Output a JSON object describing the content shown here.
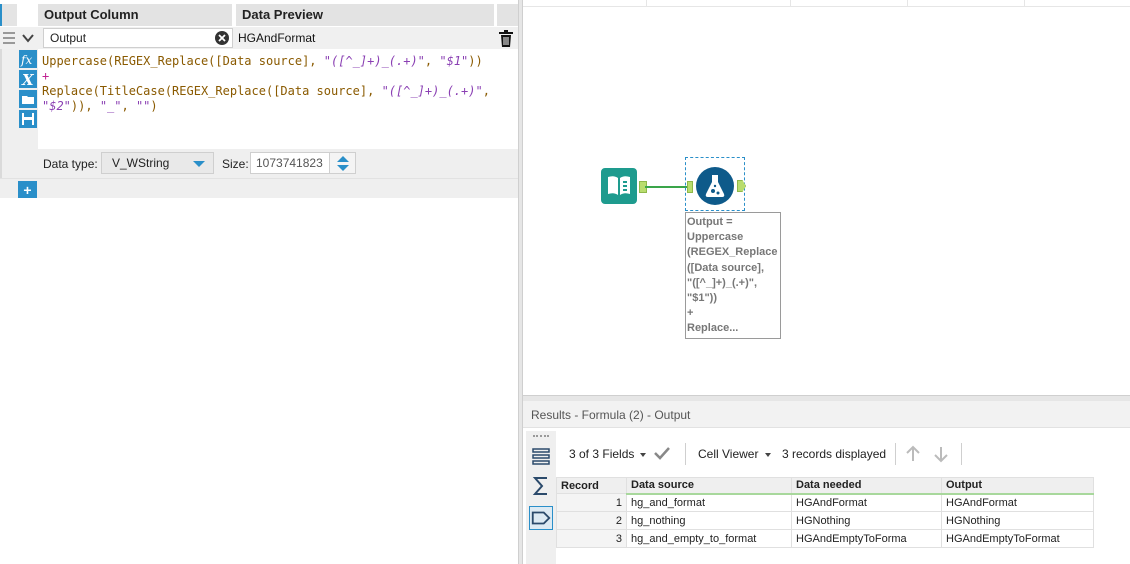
{
  "config": {
    "header": {
      "output_column": "Output Column",
      "data_preview": "Data Preview"
    },
    "expression_row": {
      "output_field": "Output",
      "preview_value": "HGAndFormat"
    },
    "expression": {
      "line1_fn": "Uppercase(REGEX_Replace([Data source], ",
      "line1_pattern": "\"([^_]+)_(.+)\"",
      "line1_sep": ", ",
      "line1_replacement": "\"$1\"",
      "line1_close": "))",
      "line2": "+",
      "line3_fn": "Replace(TitleCase(REGEX_Replace([Data source], ",
      "line3_pattern": "\"([^_]+)_(.+)\"",
      "line3_sep": ",",
      "line4_replacement": "\"$2\"",
      "line4_mid": ")), ",
      "line4_find": "\"_\"",
      "line4_sep": ", ",
      "line4_empty": "\"\"",
      "line4_close": ")"
    },
    "data_type_label": "Data type:",
    "data_type_value": "V_WString",
    "size_label": "Size:",
    "size_value": "1073741823",
    "add_label": "+"
  },
  "canvas": {
    "annotation": "Output =\nUppercase\n(REGEX_Replace\n([Data source],\n\"([^_]+)_(.+)\",\n\"$1\"))\n+\nReplace..."
  },
  "results": {
    "title": "Results - Formula (2) - Output",
    "fields_count": "3 of 3 Fields",
    "cell_viewer": "Cell Viewer",
    "records_displayed": "3 records displayed",
    "columns": [
      "Record",
      "Data source",
      "Data needed",
      "Output"
    ],
    "rows": [
      {
        "record": "1",
        "data_source": "hg_and_format",
        "data_needed": "HGAndFormat",
        "output": "HGAndFormat"
      },
      {
        "record": "2",
        "data_source": "hg_nothing",
        "data_needed": "HGNothing",
        "output": "HGNothing"
      },
      {
        "record": "3",
        "data_source": "hg_and_empty_to_format",
        "data_needed": "HGAndEmptyToForma",
        "output": "HGAndEmptyToFormat"
      }
    ]
  },
  "colors": {
    "accent_blue": "#2a8fc9",
    "tool_teal": "#1e9b8e",
    "tool_navy": "#0e5a8a",
    "connection_green": "#3aa54a",
    "string_purple": "#8a3fb3",
    "function_brown": "#8a5a00"
  },
  "icons": [
    "grip-icon",
    "chevron-down-icon",
    "clear-icon",
    "trash-icon",
    "fx-icon",
    "variable-icon",
    "folder-open-icon",
    "save-icon",
    "plus-icon",
    "input-data-icon",
    "formula-flask-icon",
    "rows-icon",
    "sum-icon",
    "tag-icon",
    "check-icon",
    "arrow-up-icon",
    "arrow-down-icon"
  ]
}
